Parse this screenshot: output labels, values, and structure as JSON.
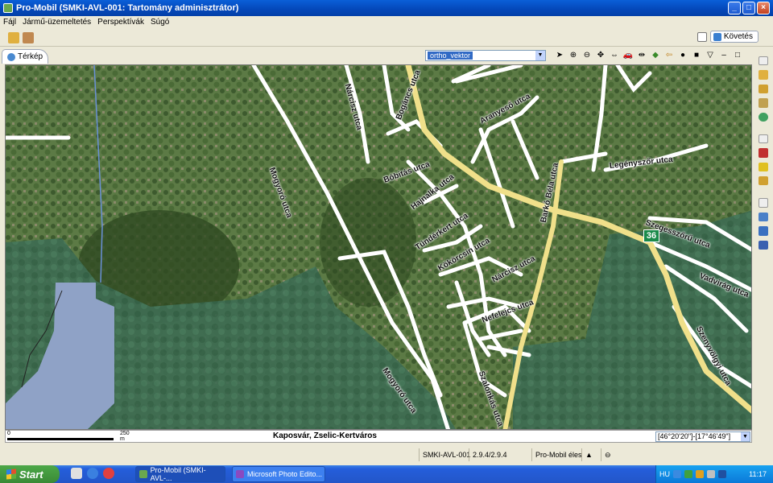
{
  "window": {
    "title": "Pro-Mobil (SMKI-AVL-001: Tartomány adminisztrátor)",
    "buttons": {
      "minimize": "_",
      "maximize": "□",
      "close": "×"
    }
  },
  "menu": {
    "items": [
      "Fájl",
      "Jármű-üzemeltetés",
      "Perspektívák",
      "Súgó"
    ]
  },
  "perspective": {
    "label": "Követés"
  },
  "view": {
    "tab_label": "Térkép",
    "layer_select": {
      "value": "ortho_vektor"
    },
    "tools": [
      "pointer-icon",
      "zoom-in-icon",
      "zoom-out-icon",
      "pan-icon",
      "zoom-extent-icon",
      "vehicle-icon",
      "measure-icon",
      "layers-icon",
      "back-icon",
      "record-icon",
      "stop-icon",
      "menu-icon"
    ]
  },
  "map": {
    "streets": [
      "Mogyoró utca",
      "Nárcisz utca",
      "Bogáncs utca",
      "Aranyeső utca",
      "Bóbitás utca",
      "Hajnalka utca",
      "Legényszőr utca",
      "Tündérkert utca",
      "Szegesszőrű utca",
      "Kökörcsin utca",
      "Nárcisz utca",
      "Nefelejcs utca",
      "Szalonkás utca",
      "Barkó Béla utca",
      "Vadvirág utca",
      "Szenyvölgyi utca",
      "Mogyoró utca"
    ],
    "route_shield": "36",
    "colors": {
      "forest": "#3d6a4a",
      "water": "#8fa4c8",
      "road_main": "#f0e08a"
    }
  },
  "map_status": {
    "scale_zero": "0",
    "scale_label": "250 m",
    "location": "Kaposvár, Zselic-Kertváros",
    "coords": "[46°20'20\"]-[17°46'49\"]"
  },
  "app_status": {
    "vehicle": "SMKI-AVL-001",
    "version": "2.9.4/2.9.4",
    "mode": "Pro-Mobil éles"
  },
  "taskbar": {
    "start": "Start",
    "tasks": [
      "Pro-Mobil (SMKI-AVL-...",
      "Microsoft Photo Edito..."
    ],
    "lang": "HU",
    "clock": "11:17"
  }
}
